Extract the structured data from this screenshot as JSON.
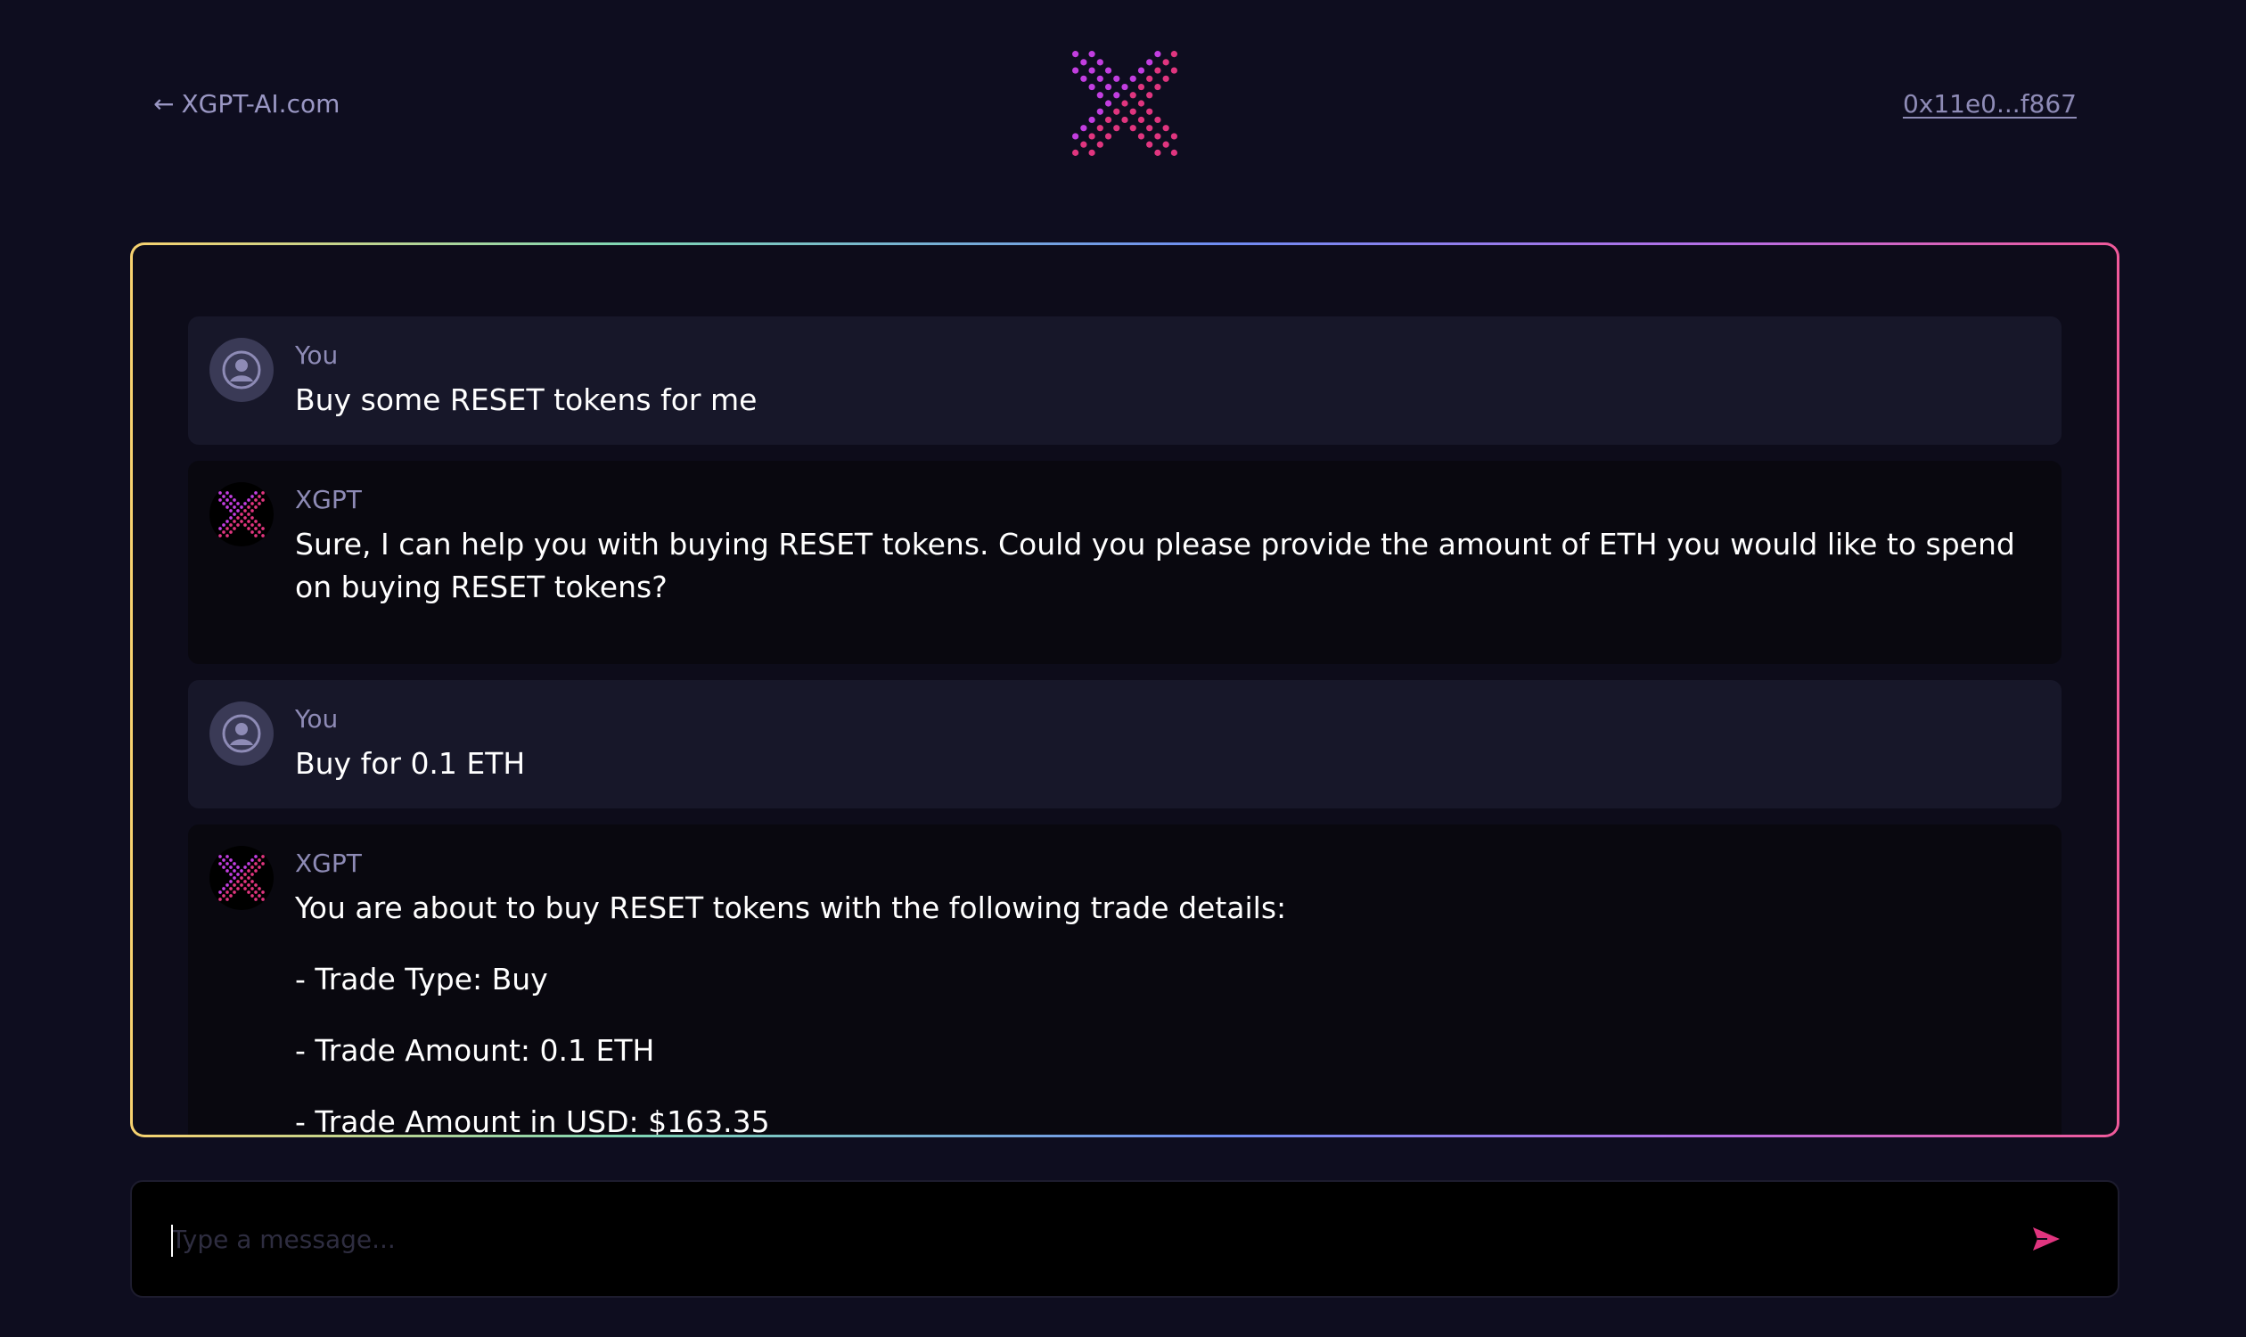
{
  "header": {
    "back_arrow": "←",
    "back_link_label": "XGPT-AI.com",
    "wallet_address": "0x11e0...f867",
    "logo_icon": "xgpt-dotted-x-logo"
  },
  "colors": {
    "background": "#0e0d1f",
    "accent_pink": "#e0357f",
    "accent_magenta": "#c23ee0",
    "muted_text": "#8e8bb6"
  },
  "messages": [
    {
      "sender": "You",
      "role": "user",
      "avatar_icon": "user-avatar-icon",
      "paragraphs": [
        "Buy some RESET tokens for me"
      ]
    },
    {
      "sender": "XGPT",
      "role": "bot",
      "avatar_icon": "xgpt-avatar-icon",
      "paragraphs": [
        "Sure, I can help you with buying RESET tokens. Could you please provide the amount of ETH you would like to spend on buying RESET tokens?"
      ]
    },
    {
      "sender": "You",
      "role": "user",
      "avatar_icon": "user-avatar-icon",
      "paragraphs": [
        "Buy for 0.1 ETH"
      ]
    },
    {
      "sender": "XGPT",
      "role": "bot",
      "avatar_icon": "xgpt-avatar-icon",
      "paragraphs": [
        "You are about to buy RESET tokens with the following trade details:",
        "- Trade Type: Buy",
        "- Trade Amount: 0.1 ETH",
        "- Trade Amount in USD: $163.35"
      ]
    }
  ],
  "composer": {
    "placeholder": "Type a message...",
    "value": "",
    "send_icon": "send-icon"
  }
}
